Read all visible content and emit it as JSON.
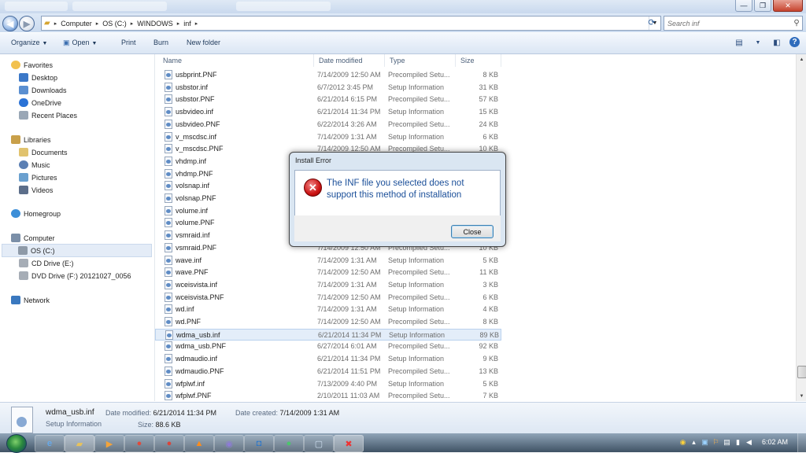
{
  "window": {
    "minimize": "—",
    "maximize": "❐",
    "close": "✕"
  },
  "address": {
    "crumbs": [
      "Computer",
      "OS (C:)",
      "WINDOWS",
      "inf"
    ],
    "search_placeholder": "Search inf"
  },
  "toolbar": {
    "organize": "Organize",
    "open": "Open",
    "print": "Print",
    "burn": "Burn",
    "new_folder": "New folder",
    "help_icon": "?"
  },
  "nav": {
    "favorites": "Favorites",
    "desktop": "Desktop",
    "downloads": "Downloads",
    "onedrive": "OneDrive",
    "recent": "Recent Places",
    "libraries": "Libraries",
    "documents": "Documents",
    "music": "Music",
    "pictures": "Pictures",
    "videos": "Videos",
    "homegroup": "Homegroup",
    "computer": "Computer",
    "os": "OS (C:)",
    "cd": "CD Drive (E:)",
    "dvd": "DVD Drive (F:) 20121027_0056",
    "network": "Network"
  },
  "columns": {
    "name": "Name",
    "date": "Date modified",
    "type": "Type",
    "size": "Size"
  },
  "files": [
    {
      "name": "usbprint.PNF",
      "date": "7/14/2009 12:50 AM",
      "type": "Precompiled Setu...",
      "size": "8 KB"
    },
    {
      "name": "usbstor.inf",
      "date": "6/7/2012 3:45 PM",
      "type": "Setup Information",
      "size": "31 KB"
    },
    {
      "name": "usbstor.PNF",
      "date": "6/21/2014 6:15 PM",
      "type": "Precompiled Setu...",
      "size": "57 KB"
    },
    {
      "name": "usbvideo.inf",
      "date": "6/21/2014 11:34 PM",
      "type": "Setup Information",
      "size": "15 KB"
    },
    {
      "name": "usbvideo.PNF",
      "date": "6/22/2014 3:26 AM",
      "type": "Precompiled Setu...",
      "size": "24 KB"
    },
    {
      "name": "v_mscdsc.inf",
      "date": "7/14/2009 1:31 AM",
      "type": "Setup Information",
      "size": "6 KB"
    },
    {
      "name": "v_mscdsc.PNF",
      "date": "7/14/2009 12:50 AM",
      "type": "Precompiled Setu...",
      "size": "10 KB"
    },
    {
      "name": "vhdmp.inf",
      "date": "",
      "type": "",
      "size": ""
    },
    {
      "name": "vhdmp.PNF",
      "date": "",
      "type": "",
      "size": ""
    },
    {
      "name": "volsnap.inf",
      "date": "",
      "type": "",
      "size": ""
    },
    {
      "name": "volsnap.PNF",
      "date": "",
      "type": "",
      "size": ""
    },
    {
      "name": "volume.inf",
      "date": "",
      "type": "",
      "size": ""
    },
    {
      "name": "volume.PNF",
      "date": "",
      "type": "",
      "size": ""
    },
    {
      "name": "vsmraid.inf",
      "date": "",
      "type": "",
      "size": ""
    },
    {
      "name": "vsmraid.PNF",
      "date": "7/14/2009 12:50 AM",
      "type": "Precompiled Setu...",
      "size": "10 KB"
    },
    {
      "name": "wave.inf",
      "date": "7/14/2009 1:31 AM",
      "type": "Setup Information",
      "size": "5 KB"
    },
    {
      "name": "wave.PNF",
      "date": "7/14/2009 12:50 AM",
      "type": "Precompiled Setu...",
      "size": "11 KB"
    },
    {
      "name": "wceisvista.inf",
      "date": "7/14/2009 1:31 AM",
      "type": "Setup Information",
      "size": "3 KB"
    },
    {
      "name": "wceisvista.PNF",
      "date": "7/14/2009 12:50 AM",
      "type": "Precompiled Setu...",
      "size": "6 KB"
    },
    {
      "name": "wd.inf",
      "date": "7/14/2009 1:31 AM",
      "type": "Setup Information",
      "size": "4 KB"
    },
    {
      "name": "wd.PNF",
      "date": "7/14/2009 12:50 AM",
      "type": "Precompiled Setu...",
      "size": "8 KB"
    },
    {
      "name": "wdma_usb.inf",
      "date": "6/21/2014 11:34 PM",
      "type": "Setup Information",
      "size": "89 KB"
    },
    {
      "name": "wdma_usb.PNF",
      "date": "6/27/2014 6:01 AM",
      "type": "Precompiled Setu...",
      "size": "92 KB"
    },
    {
      "name": "wdmaudio.inf",
      "date": "6/21/2014 11:34 PM",
      "type": "Setup Information",
      "size": "9 KB"
    },
    {
      "name": "wdmaudio.PNF",
      "date": "6/21/2014 11:51 PM",
      "type": "Precompiled Setu...",
      "size": "13 KB"
    },
    {
      "name": "wfplwf.inf",
      "date": "7/13/2009 4:40 PM",
      "type": "Setup Information",
      "size": "5 KB"
    },
    {
      "name": "wfplwf.PNF",
      "date": "2/10/2011 11:03 AM",
      "type": "Precompiled Setu...",
      "size": "7 KB"
    }
  ],
  "selected_file_index": 21,
  "details": {
    "filename": "wdma_usb.inf",
    "type": "Setup Information",
    "modified_label": "Date modified:",
    "modified": "6/21/2014 11:34 PM",
    "created_label": "Date created:",
    "created": "7/14/2009 1:31 AM",
    "size_label": "Size:",
    "size": "88.6 KB"
  },
  "dialog": {
    "title": "Install Error",
    "message": "The INF file you selected does not support this method of installation",
    "close_button": "Close",
    "icon": "error-icon"
  },
  "taskbar": {
    "clock": "6:02 AM"
  }
}
